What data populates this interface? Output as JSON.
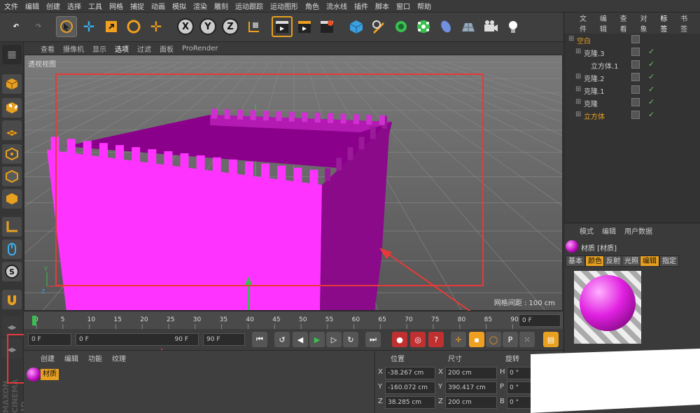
{
  "menubar": {
    "items": [
      "文件",
      "编辑",
      "创建",
      "选择",
      "工具",
      "网格",
      "捕捉",
      "动画",
      "模拟",
      "渲染",
      "雕刻",
      "运动跟踪",
      "运动图形",
      "角色",
      "流水线",
      "插件",
      "脚本",
      "窗口",
      "帮助"
    ]
  },
  "viewport": {
    "menu": [
      "查看",
      "摄像机",
      "显示",
      "选项",
      "过滤",
      "面板",
      "ProRender"
    ],
    "active_menu": "选项",
    "title": "透视视图",
    "grid_info": "网格间距 : 100 cm"
  },
  "timeline": {
    "ticks": [
      "0",
      "5",
      "10",
      "15",
      "20",
      "25",
      "30",
      "35",
      "40",
      "45",
      "50",
      "55",
      "60",
      "65",
      "70",
      "75",
      "80",
      "85",
      "90"
    ],
    "current_frame": "0 F"
  },
  "playbar": {
    "start_frame": "0 F",
    "range_start": "0 F",
    "range_end": "90 F",
    "end_frame": "90 F"
  },
  "material_manager": {
    "menu": [
      "创建",
      "编辑",
      "功能",
      "纹理"
    ],
    "material_name": "材质"
  },
  "coordinates": {
    "headers": {
      "position": "位置",
      "size": "尺寸",
      "rotation": "旋转"
    },
    "rows": [
      {
        "axis": "X",
        "pos": "-38.267 cm",
        "size_axis": "X",
        "size": "200 cm",
        "rot_axis": "H",
        "rot": "0 °"
      },
      {
        "axis": "Y",
        "pos": "-160.072 cm",
        "size_axis": "Y",
        "size": "390.417 cm",
        "rot_axis": "P",
        "rot": "0 °"
      },
      {
        "axis": "Z",
        "pos": "38.285 cm",
        "size_axis": "Z",
        "size": "200 cm",
        "rot_axis": "B",
        "rot": "0 °"
      }
    ]
  },
  "object_manager": {
    "menu": [
      "文件",
      "编辑",
      "查看",
      "对象",
      "标签",
      "书签"
    ],
    "active_menu": "标签",
    "objects": [
      {
        "name": "空白",
        "level": 0,
        "highlight": true
      },
      {
        "name": "克隆.3",
        "level": 1
      },
      {
        "name": "立方体.1",
        "level": 2
      },
      {
        "name": "克隆.2",
        "level": 1
      },
      {
        "name": "克隆.1",
        "level": 1
      },
      {
        "name": "克隆",
        "level": 1
      },
      {
        "name": "立方体",
        "level": 1,
        "highlight": true
      }
    ]
  },
  "attribute_manager": {
    "menu": [
      "模式",
      "编辑",
      "用户数据"
    ],
    "title": "材质 [材质]",
    "tabs": [
      "基本",
      "颜色",
      "反射",
      "光照",
      "编辑",
      "指定"
    ],
    "active_tabs": [
      "颜色",
      "编辑"
    ]
  },
  "brand": {
    "logo_text": "MAXON CINEMA 4D"
  },
  "colors": {
    "accent": "#e8a020",
    "magenta": "#ff33ff",
    "annotation_red": "#e63a3a"
  }
}
